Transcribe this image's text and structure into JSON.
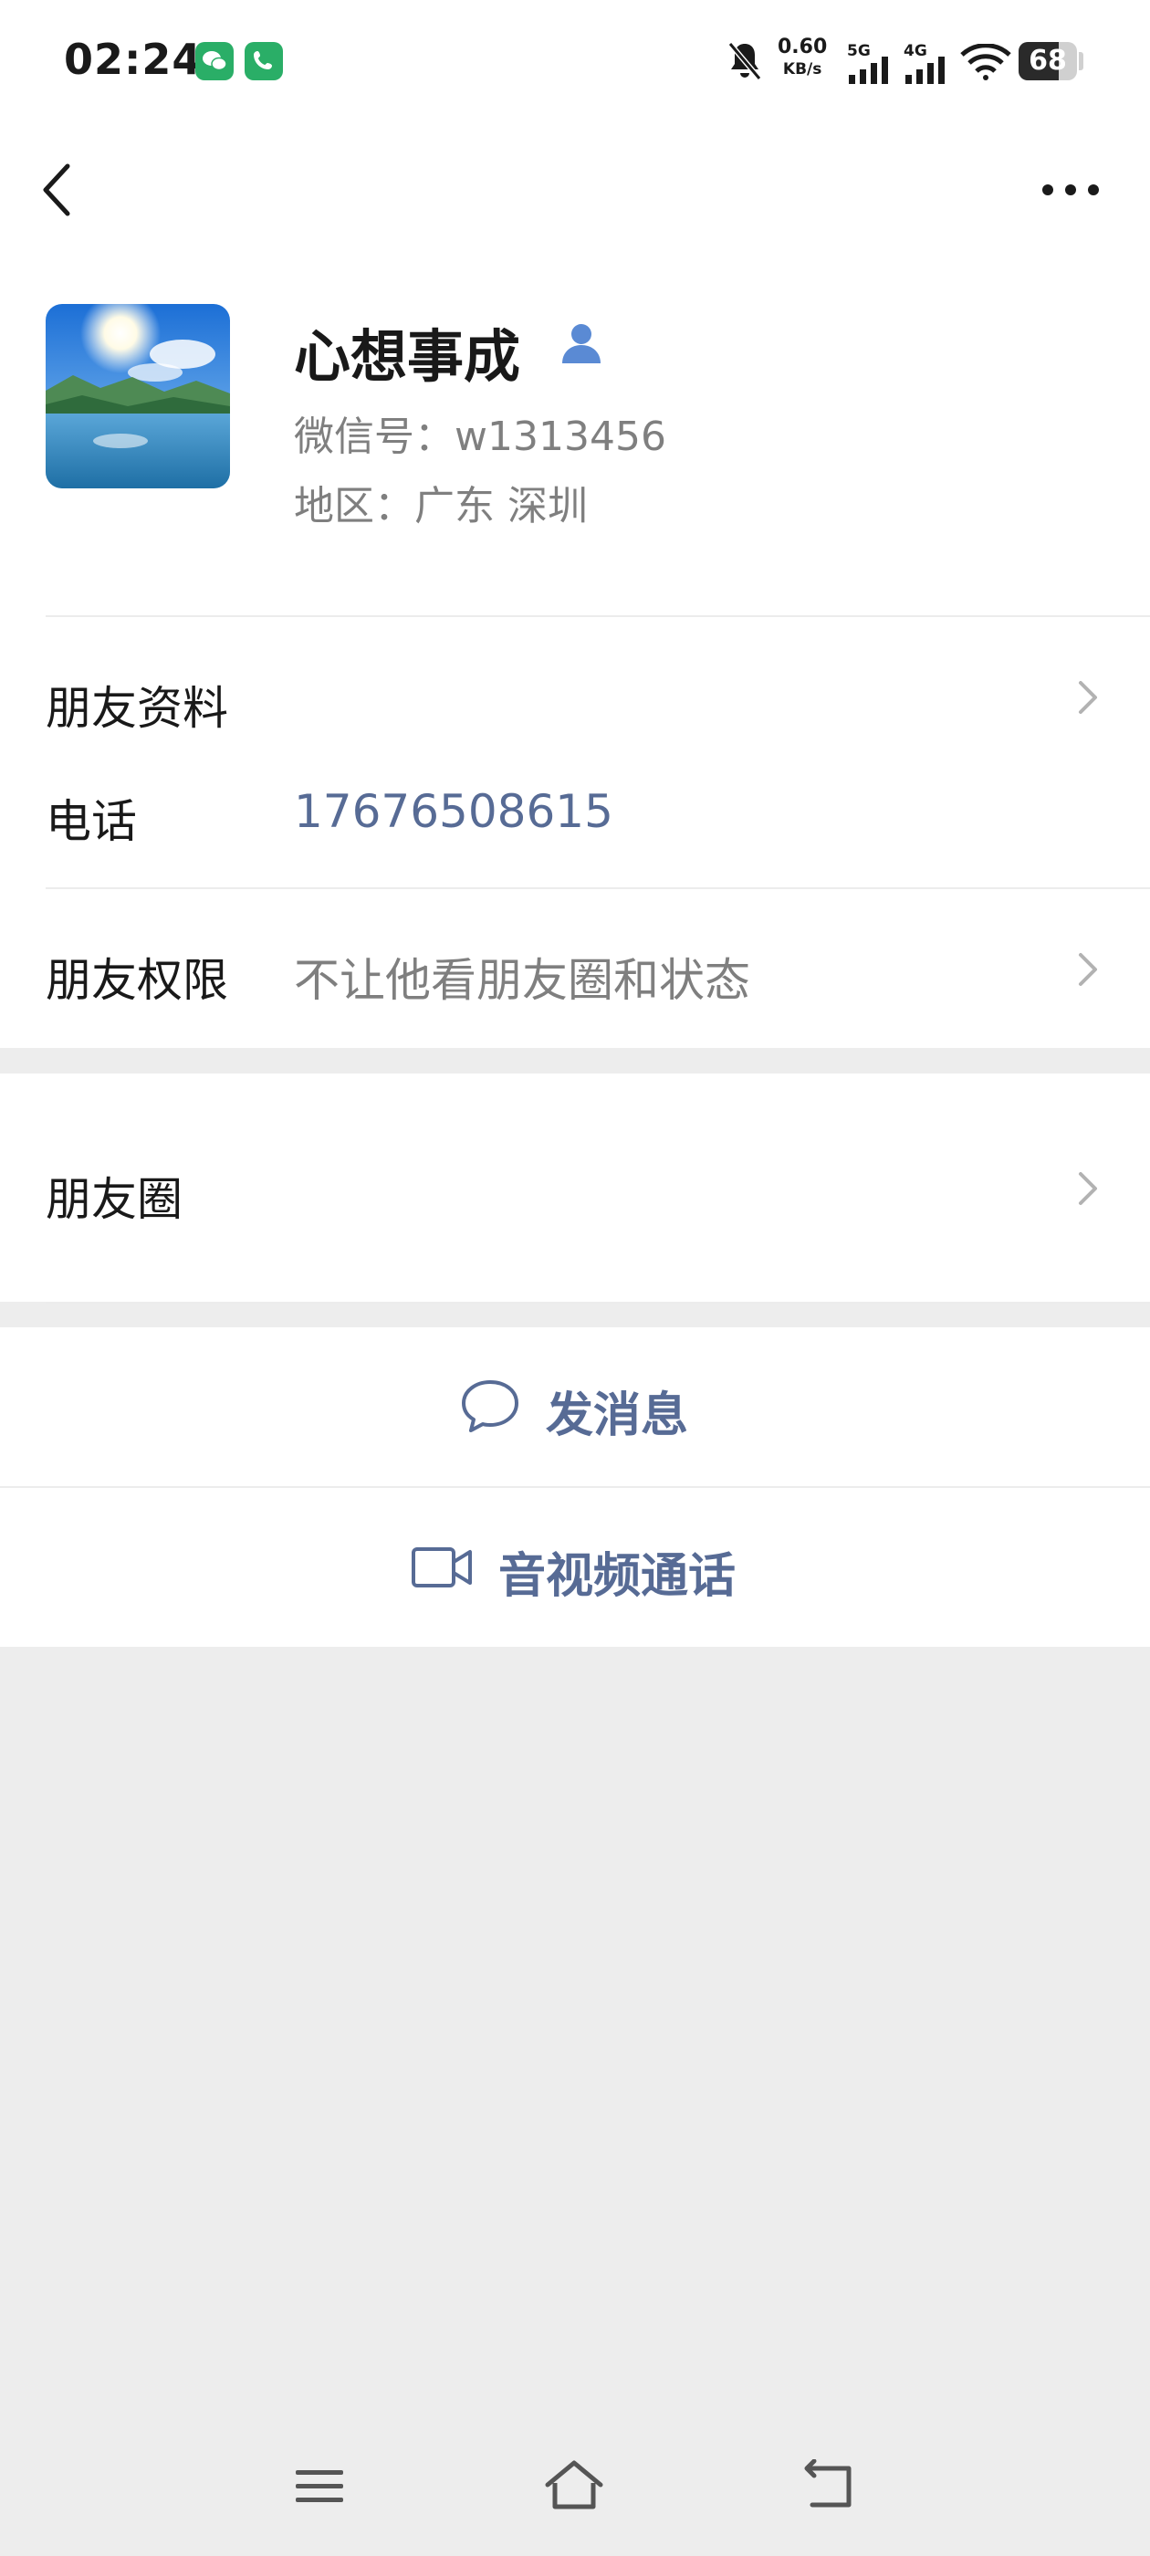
{
  "status_bar": {
    "time": "02:24",
    "net_speed": "0.60",
    "net_unit": "KB/s",
    "sig1": "5G",
    "sig2": "4G",
    "battery": "68",
    "battery_level": 0.68,
    "icons": [
      "wechat-icon",
      "phone-icon",
      "mute-bell-icon",
      "signal-icon",
      "wifi-icon",
      "battery-icon"
    ]
  },
  "nav": {
    "back_icon": "chevron-left-icon",
    "more_icon": "more-dots-icon"
  },
  "profile": {
    "name": "心想事成",
    "wechat_id": "微信号：w1313456",
    "region": "地区：广东  深圳"
  },
  "rows": {
    "friend_info": "朋友资料",
    "phone_label": "电话",
    "phone_value": "17676508615",
    "permission_label": "朋友权限",
    "permission_value": "不让他看朋友圈和状态",
    "moments": "朋友圈"
  },
  "actions": {
    "message": "发消息",
    "call": "音视频通话"
  },
  "colors": {
    "link": "#576b95",
    "bg": "#ededed",
    "accent_green": "#2aae67"
  }
}
